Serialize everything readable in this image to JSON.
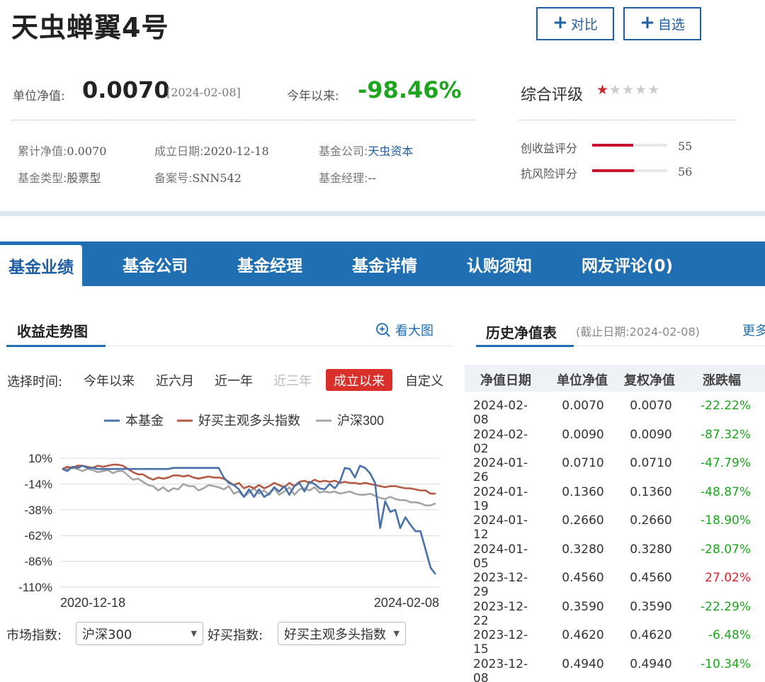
{
  "header": {
    "title": "天虫蝉翼4号",
    "compare_label": "对比",
    "watch_label": "自选"
  },
  "summary": {
    "nav_label": "单位净值:",
    "nav_value": "0.0070",
    "nav_date": "[2024-02-08]",
    "ytd_label": "今年以来:",
    "ytd_value": "-98.46%"
  },
  "info": {
    "acc_nav_label": "累计净值:",
    "acc_nav_value": "0.0070",
    "est_date_label": "成立日期:",
    "est_date_value": "2020-12-18",
    "company_label": "基金公司:",
    "company_value": "天虫资本",
    "type_label": "基金类型:",
    "type_value": "股票型",
    "record_label": "备案号:",
    "record_value": "SNN542",
    "manager_label": "基金经理:",
    "manager_value": "--"
  },
  "rating": {
    "title": "综合评级",
    "stars": 1,
    "stars_total": 5,
    "return_label": "创收益评分",
    "return_score": 55,
    "risk_label": "抗风险评分",
    "risk_score": 56
  },
  "tabs": [
    {
      "label": "基金业绩",
      "active": true
    },
    {
      "label": "基金公司"
    },
    {
      "label": "基金经理"
    },
    {
      "label": "基金详情"
    },
    {
      "label": "认购须知"
    },
    {
      "label": "网友评论(0)"
    }
  ],
  "performance": {
    "title": "收益走势图",
    "zoom_label": "看大图",
    "time_label": "选择时间:",
    "ranges": [
      {
        "label": "今年以来"
      },
      {
        "label": "近六月"
      },
      {
        "label": "近一年"
      },
      {
        "label": "近三年",
        "disabled": true
      },
      {
        "label": "成立以来",
        "active": true
      },
      {
        "label": "自定义"
      }
    ],
    "market_label": "市场指数:",
    "market_value": "沪深300",
    "haomai_label": "好买指数:",
    "haomai_value": "好买主观多头指数"
  },
  "chart_data": {
    "type": "line",
    "legend_position": "top",
    "y_ticks": [
      "10%",
      "-14%",
      "-38%",
      "-62%",
      "-86%",
      "-110%"
    ],
    "ylim": [
      -110,
      10
    ],
    "x_tick_labels": [
      "2020-12-18",
      "2024-02-08"
    ],
    "x_range": [
      "2020-12-18",
      "2024-02-08"
    ],
    "grid": true,
    "series": [
      {
        "name": "本基金",
        "color": "#4a72a8",
        "values": [
          0,
          -2,
          2,
          1,
          3,
          1,
          1,
          0,
          0,
          0,
          0,
          0,
          0,
          0,
          0,
          0,
          0,
          0,
          0,
          0,
          0,
          0,
          1,
          1,
          1,
          1,
          1,
          1,
          1,
          1,
          1,
          1,
          -8,
          -13,
          -15,
          -19,
          -26,
          -19,
          -26,
          -19,
          -26,
          -23,
          -17,
          -21,
          -16,
          -24,
          -16,
          -13,
          -21,
          -12,
          -14,
          -18,
          -19,
          -14,
          -18,
          -12,
          1,
          0,
          -8,
          3,
          1,
          -4,
          -13,
          -55,
          -30,
          -40,
          -38,
          -55,
          -45,
          -52,
          -58,
          -58,
          -75,
          -92,
          -98
        ]
      },
      {
        "name": "好买主观多头指数",
        "color": "#b55a45",
        "values": [
          0,
          2,
          1,
          3,
          3,
          2,
          1,
          3,
          2,
          3,
          4,
          4,
          3,
          0,
          -3,
          -5,
          -5,
          -8,
          -10,
          -8,
          -9,
          -8,
          -6,
          -6,
          -7,
          -6,
          -8,
          -9,
          -8,
          -7,
          -8,
          -8,
          -9,
          -12,
          -15,
          -13,
          -18,
          -16,
          -18,
          -15,
          -18,
          -16,
          -13,
          -15,
          -17,
          -13,
          -16,
          -12,
          -11,
          -13,
          -10,
          -12,
          -11,
          -12,
          -11,
          -13,
          -12,
          -13,
          -13,
          -14,
          -13,
          -14,
          -15,
          -16,
          -17,
          -16,
          -16,
          -17,
          -18,
          -18,
          -19,
          -20,
          -20,
          -23,
          -23
        ]
      },
      {
        "name": "沪深300",
        "color": "#a5a5a5",
        "values": [
          0,
          0,
          1,
          0,
          -2,
          0,
          -1,
          -3,
          -2,
          -1,
          -4,
          -2,
          -2,
          -6,
          -10,
          -9,
          -12,
          -15,
          -16,
          -20,
          -17,
          -21,
          -18,
          -19,
          -14,
          -16,
          -16,
          -20,
          -18,
          -15,
          -16,
          -17,
          -19,
          -16,
          -23,
          -21,
          -26,
          -22,
          -18,
          -23,
          -20,
          -24,
          -18,
          -24,
          -21,
          -17,
          -24,
          -19,
          -18,
          -20,
          -17,
          -22,
          -21,
          -22,
          -21,
          -23,
          -22,
          -21,
          -23,
          -24,
          -24,
          -23,
          -25,
          -27,
          -28,
          -26,
          -28,
          -29,
          -29,
          -31,
          -31,
          -32,
          -34,
          -34,
          -32
        ]
      }
    ]
  },
  "history": {
    "title": "历史净值表",
    "cutoff": "(截止日期:2024-02-08)",
    "more_label": "更多",
    "columns": [
      "净值日期",
      "单位净值",
      "复权净值",
      "涨跌幅"
    ],
    "rows": [
      {
        "date": "2024-02-08",
        "nav": "0.0070",
        "adj_nav": "0.0070",
        "change": "-22.22%"
      },
      {
        "date": "2024-02-02",
        "nav": "0.0090",
        "adj_nav": "0.0090",
        "change": "-87.32%"
      },
      {
        "date": "2024-01-26",
        "nav": "0.0710",
        "adj_nav": "0.0710",
        "change": "-47.79%"
      },
      {
        "date": "2024-01-19",
        "nav": "0.1360",
        "adj_nav": "0.1360",
        "change": "-48.87%"
      },
      {
        "date": "2024-01-12",
        "nav": "0.2660",
        "adj_nav": "0.2660",
        "change": "-18.90%"
      },
      {
        "date": "2024-01-05",
        "nav": "0.3280",
        "adj_nav": "0.3280",
        "change": "-28.07%"
      },
      {
        "date": "2023-12-29",
        "nav": "0.4560",
        "adj_nav": "0.4560",
        "change": "27.02%"
      },
      {
        "date": "2023-12-22",
        "nav": "0.3590",
        "adj_nav": "0.3590",
        "change": "-22.29%"
      },
      {
        "date": "2023-12-15",
        "nav": "0.4620",
        "adj_nav": "0.4620",
        "change": "-6.48%"
      },
      {
        "date": "2023-12-08",
        "nav": "0.4940",
        "adj_nav": "0.4940",
        "change": "-10.34%"
      }
    ]
  },
  "colors": {
    "brand_blue": "#1f6fb2",
    "up_red": "#e0222c",
    "down_green": "#1ea51e",
    "active_range_red": "#d9302c"
  }
}
